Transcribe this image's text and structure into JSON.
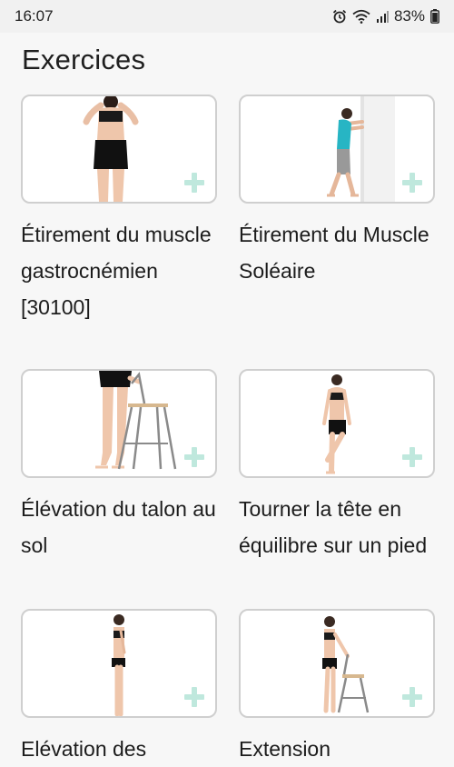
{
  "status": {
    "time": "16:07",
    "battery": "83%"
  },
  "page": {
    "title": "Exercices"
  },
  "exercises": [
    {
      "title": "Étirement du muscle gastrocnémien [30100]"
    },
    {
      "title": "Étirement du Muscle Soléaire"
    },
    {
      "title": "Élévation du talon au sol"
    },
    {
      "title": "Tourner la tête en équilibre sur un pied"
    },
    {
      "title": "Elévation des"
    },
    {
      "title": "Extension"
    }
  ],
  "icons": {
    "add": "plus-icon",
    "alarm": "alarm-icon",
    "wifi": "wifi-icon",
    "signal": "signal-icon",
    "battery": "battery-icon"
  },
  "colors": {
    "add_icon": "#bfe8dd",
    "card_border": "#cfcfcf",
    "background": "#f7f7f7"
  }
}
